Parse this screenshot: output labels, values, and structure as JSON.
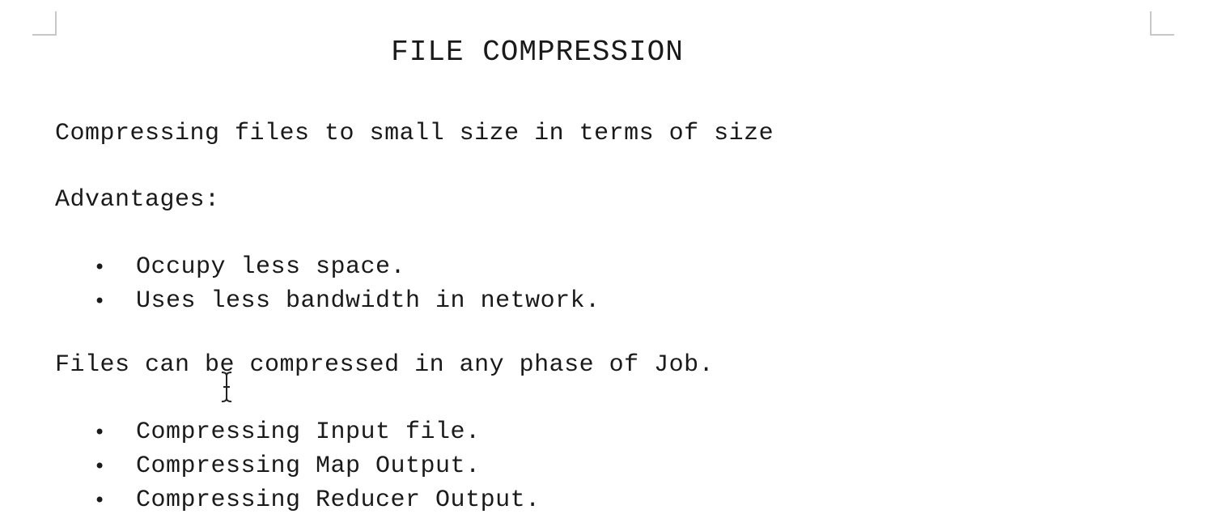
{
  "document": {
    "title": "FILE COMPRESSION",
    "intro": "Compressing files to small size in terms of size",
    "advantages_heading": "Advantages:",
    "advantages": [
      "Occupy less space.",
      "Uses less bandwidth in network."
    ],
    "phase_text": "Files can be compressed in any phase of Job.",
    "phases": [
      "Compressing Input file.",
      "Compressing Map Output.",
      "Compressing Reducer Output."
    ],
    "bullet_glyph": "•"
  },
  "cursor": {
    "icon": "text-cursor-icon"
  }
}
